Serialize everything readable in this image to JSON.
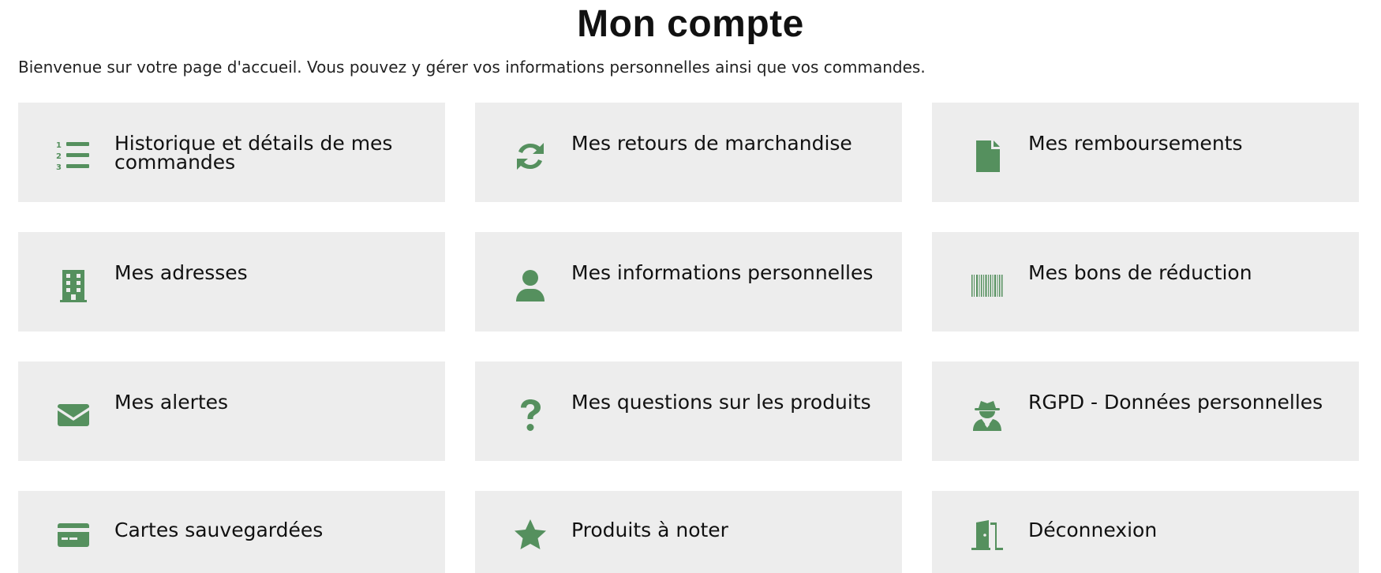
{
  "page": {
    "title": "Mon compte",
    "intro": "Bienvenue sur votre page d'accueil. Vous pouvez y gérer vos informations personnelles ainsi que vos commandes."
  },
  "theme": {
    "accent": "#55905e",
    "tile_bg": "#ededed"
  },
  "tiles": [
    {
      "label": "Historique et détails de mes commandes",
      "icon": "ordered-list-icon"
    },
    {
      "label": "Mes retours de marchandise",
      "icon": "sync-icon"
    },
    {
      "label": "Mes remboursements",
      "icon": "document-icon"
    },
    {
      "label": "Mes adresses",
      "icon": "building-icon"
    },
    {
      "label": "Mes informations personnelles",
      "icon": "user-icon"
    },
    {
      "label": "Mes bons de réduction",
      "icon": "barcode-icon"
    },
    {
      "label": "Mes alertes",
      "icon": "envelope-icon"
    },
    {
      "label": "Mes questions sur les produits",
      "icon": "question-icon"
    },
    {
      "label": "RGPD - Données personnelles",
      "icon": "user-secret-icon"
    },
    {
      "label": "Cartes sauvegardées",
      "icon": "credit-card-icon"
    },
    {
      "label": "Produits à noter",
      "icon": "star-icon"
    },
    {
      "label": "Déconnexion",
      "icon": "door-exit-icon"
    }
  ]
}
